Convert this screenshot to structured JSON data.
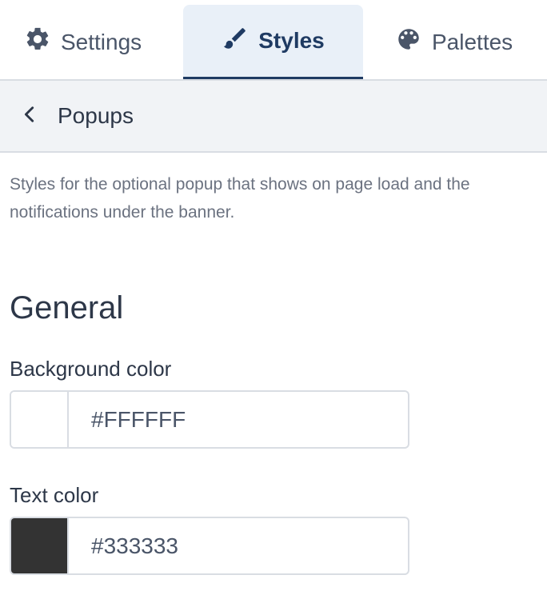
{
  "tabs": {
    "settings": {
      "label": "Settings",
      "icon": "gear-icon"
    },
    "styles": {
      "label": "Styles",
      "icon": "brush-icon",
      "active": true
    },
    "palettes": {
      "label": "Palettes",
      "icon": "palette-icon"
    }
  },
  "breadcrumb": {
    "back_icon": "chevron-left-icon",
    "title": "Popups"
  },
  "description": "Styles for the optional popup that shows on page load and the notifications under the banner.",
  "section": {
    "title": "General"
  },
  "fields": {
    "background_color": {
      "label": "Background color",
      "value": "#FFFFFF",
      "swatch": "#FFFFFF"
    },
    "text_color": {
      "label": "Text color",
      "value": "#333333",
      "swatch": "#333333"
    }
  },
  "colors": {
    "accent": "#1F3B63",
    "active_tab_bg": "#E9F0F8",
    "breadcrumb_bg": "#F1F3F6",
    "border": "#D9DDE3"
  }
}
